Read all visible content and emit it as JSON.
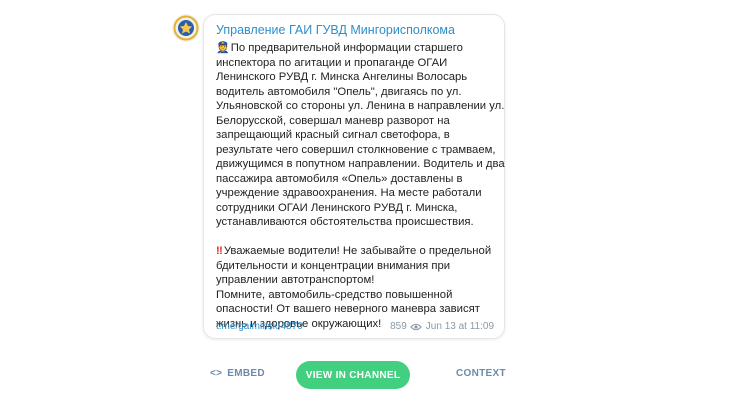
{
  "post": {
    "channel_name": "Управление ГАИ ГУВД Мингорисполкома",
    "paragraph1_emoji": "👮",
    "paragraph1": "По предварительной информации старшего инспектора по агитации и пропаганде ОГАИ Ленинского РУВД г. Минска Ангелины Волосарь водитель автомобиля \"Опель\", двигаясь по ул. Ульяновской со стороны ул. Ленина в направлении ул. Белорусской, совершал маневр разворот на запрещающий красный сигнал светофора, в результате чего совершил столкновение с трамваем, движущимся в попутном направлении. Водитель и два пассажира автомобиля «Опель» доставлены в учреждение здравоохранения. На месте работали сотрудники  ОГАИ Ленинского РУВД г. Минска, устанавливаются обстоятельства происшествия.",
    "paragraph2_emoji": "‼",
    "paragraph2_line1": "Уважаемые водители! Не забывайте о предельной бдительности и концентрации внимания при управлении автотранспортом!",
    "paragraph2_line2": "Помните, автомобиль-средство повышенной опасности! От вашего неверного маневра зависят жизнь и здоровье окружающих!",
    "link": "t.me/gaiminsk/4870",
    "views": "859",
    "date": "Jun 13 at 11:09"
  },
  "actions": {
    "embed_label": "EMBED",
    "embed_icon": "<>",
    "view_label": "VIEW IN CHANNEL",
    "context_label": "CONTEXT"
  },
  "colors": {
    "link": "#2f8ec9",
    "button": "#42cf80",
    "muted": "#6c8bab"
  },
  "icons": {
    "avatar": "police-emblem-avatar",
    "views": "eye-icon",
    "embed": "code-brackets-icon"
  }
}
